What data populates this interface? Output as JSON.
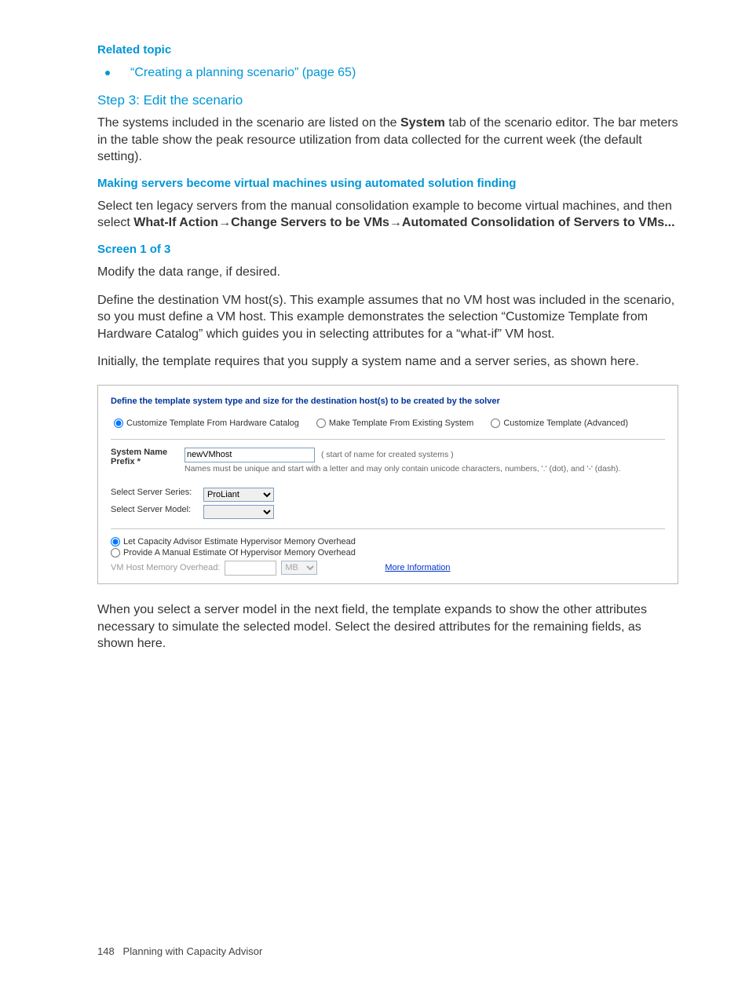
{
  "relatedTopic": {
    "heading": "Related topic",
    "link": "“Creating a planning scenario” (page 65)"
  },
  "step3": {
    "heading": "Step 3: Edit the scenario",
    "p1_a": "The systems included in the scenario are listed on the ",
    "p1_bold": "System",
    "p1_b": " tab of the scenario editor. The bar meters in the table show the peak resource utilization from data collected for the current week (the default setting)."
  },
  "making": {
    "heading": "Making servers become virtual machines using automated solution finding",
    "p1_a": "Select ten legacy servers from the manual consolidation example to become virtual machines, and then select ",
    "bold1": "What-If Action",
    "arrow": "→",
    "bold2": "Change Servers to be VMs",
    "bold3": "Automated Consolidation of Servers to VMs..."
  },
  "screen1": {
    "heading": "Screen 1 of 3",
    "p1": "Modify the data range, if desired.",
    "p2": "Define the destination VM host(s). This example assumes that no VM host was included in the scenario, so you must define a VM host. This example demonstrates the selection “Customize Template from Hardware Catalog” which guides you in selecting attributes for a “what-if” VM host.",
    "p3": "Initially, the template requires that you supply a system name and a server series, as shown here."
  },
  "box": {
    "title": "Define the template system type and size for the destination host(s) to be created by the solver",
    "radio1": "Customize Template From Hardware Catalog",
    "radio2": "Make Template From Existing System",
    "radio3": "Customize Template (Advanced)",
    "sysNamePrefixLabel": "System Name Prefix *",
    "sysNamePrefixValue": "newVMhost",
    "sysNameHint": "( start of name for created systems )",
    "sysNameHelp": "Names must be unique and start with a letter and may only contain unicode characters, numbers, '.' (dot), and '-' (dash).",
    "selectSeriesLabel": "Select Server Series:",
    "selectSeriesValue": "ProLiant",
    "selectModelLabel": "Select Server Model:",
    "selectModelValue": "",
    "memRadio1": "Let Capacity Advisor Estimate Hypervisor Memory Overhead",
    "memRadio2": "Provide A Manual Estimate Of Hypervisor Memory Overhead",
    "memOverheadLabel": "VM Host Memory Overhead:",
    "memUnit": "MB",
    "moreInfo": "More Information"
  },
  "after": {
    "p1": "When you select a server model in the next field, the template expands to show the other attributes necessary to simulate the selected model. Select the desired attributes for the remaining fields, as shown here."
  },
  "footer": {
    "pageNum": "148",
    "chapter": "Planning with Capacity Advisor"
  }
}
